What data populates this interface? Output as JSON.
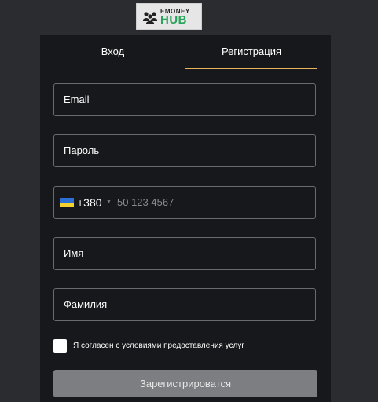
{
  "logo": {
    "top_text": "EMONEY",
    "bottom_text": "HUB",
    "brand_color": "#27a35a"
  },
  "tabs": [
    {
      "label": "Вход",
      "active": false
    },
    {
      "label": "Регистрация",
      "active": true
    }
  ],
  "accent_color": "#e8b35c",
  "form": {
    "email_label": "Email",
    "password_label": "Пароль",
    "phone": {
      "country_flag": "ukraine-flag-icon",
      "dial_code": "+380",
      "placeholder": "50 123 4567"
    },
    "first_name_label": "Имя",
    "last_name_label": "Фамилия",
    "agree": {
      "checked": false,
      "prefix": "Я согласен с ",
      "link": "условиями",
      "suffix": " предоставления услуг"
    },
    "submit_label": "Зарегистрироватся"
  }
}
